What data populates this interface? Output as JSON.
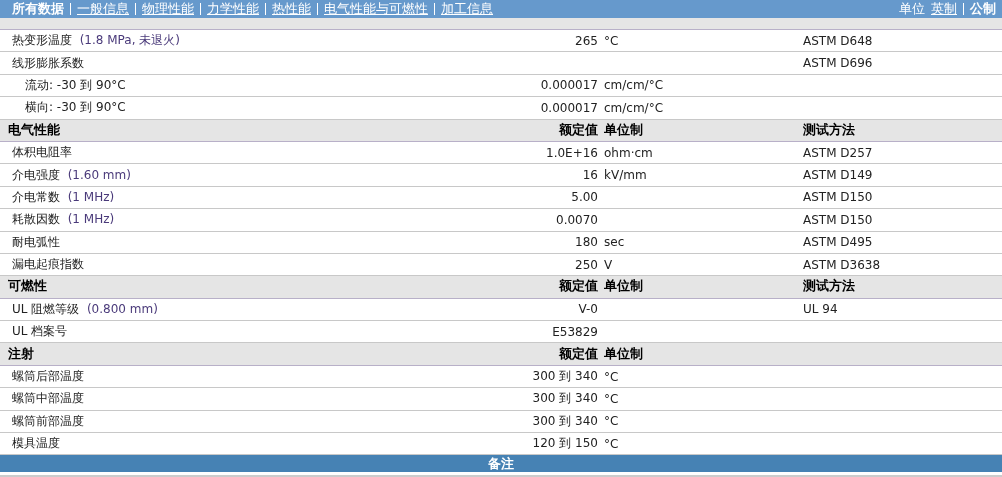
{
  "nav": {
    "tabs": [
      {
        "label": "所有数据",
        "selected": true
      },
      {
        "label": "一般信息",
        "selected": false
      },
      {
        "label": "物理性能",
        "selected": false
      },
      {
        "label": "力学性能",
        "selected": false
      },
      {
        "label": "热性能",
        "selected": false
      },
      {
        "label": "电气性能与可燃性",
        "selected": false
      },
      {
        "label": "加工信息",
        "selected": false
      }
    ],
    "units_label": "单位",
    "units": [
      {
        "label": "英制",
        "selected": false
      },
      {
        "label": "公制",
        "selected": true
      }
    ]
  },
  "sections": [
    {
      "rows": [
        {
          "name": "热变形温度",
          "condition": "(1.8 MPa, 未退火)",
          "value": "265",
          "unit": "°C",
          "method": "ASTM D648"
        },
        {
          "name": "线形膨胀系数",
          "method": "ASTM D696",
          "children": [
            {
              "name": "流动: -30 到  90°C",
              "value": "0.000017",
              "unit": "cm/cm/°C"
            },
            {
              "name": "横向: -30 到  90°C",
              "value": "0.000017",
              "unit": "cm/cm/°C"
            }
          ]
        }
      ]
    },
    {
      "title": "电气性能",
      "value_header": "额定值",
      "unit_header": "单位制",
      "method_header": "测试方法",
      "rows": [
        {
          "name": "体积电阻率",
          "value": "1.0E+16",
          "unit": "ohm·cm",
          "method": "ASTM D257"
        },
        {
          "name": "介电强度",
          "condition": "(1.60 mm)",
          "value": "16",
          "unit": "kV/mm",
          "method": "ASTM D149"
        },
        {
          "name": "介电常数",
          "condition": "(1 MHz)",
          "value": "5.00",
          "method": "ASTM D150"
        },
        {
          "name": "耗散因数",
          "condition": "(1 MHz)",
          "value": "0.0070",
          "method": "ASTM D150"
        },
        {
          "name": "耐电弧性",
          "value": "180",
          "unit": "sec",
          "method": "ASTM D495"
        },
        {
          "name": "漏电起痕指数",
          "value": "250",
          "unit": "V",
          "method": "ASTM D3638"
        }
      ]
    },
    {
      "title": "可燃性",
      "value_header": "额定值",
      "unit_header": "单位制",
      "method_header": "测试方法",
      "rows": [
        {
          "name": "UL 阻燃等级",
          "condition": "(0.800 mm)",
          "value": "V-0",
          "method": "UL 94"
        },
        {
          "name": "UL 档案号",
          "value": "E53829"
        }
      ]
    },
    {
      "title": "注射",
      "value_header": "额定值",
      "unit_header": "单位制",
      "rows": [
        {
          "name": "螺筒后部温度",
          "value": "300 到  340",
          "unit": "°C"
        },
        {
          "name": "螺筒中部温度",
          "value": "300 到  340",
          "unit": "°C"
        },
        {
          "name": "螺筒前部温度",
          "value": "300 到  340",
          "unit": "°C"
        },
        {
          "name": "模具温度",
          "value": "120 到  150",
          "unit": "°C"
        }
      ]
    }
  ],
  "notes_bar": {
    "title": "备注"
  }
}
